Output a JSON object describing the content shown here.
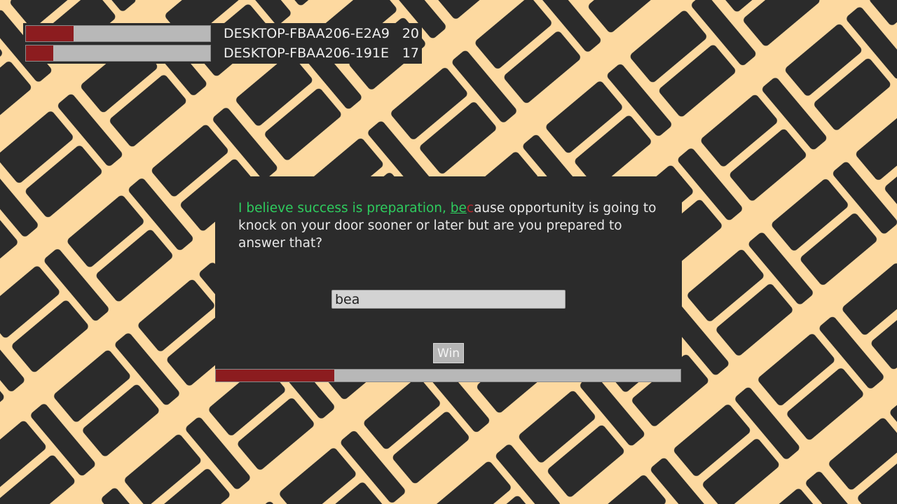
{
  "colors": {
    "background": "#fdd9a0",
    "pattern": "#2b2b2b",
    "panel": "#2b2b2b",
    "progress_fill": "#8c1c1f",
    "progress_track": "#b8b8b8",
    "typed_text": "#2ecc5e",
    "error_text": "#b3262c",
    "remaining_text": "#e8e8e8"
  },
  "leaderboard": {
    "players": [
      {
        "name": "DESKTOP-FBAA206-E2A9",
        "score": "20",
        "progress": 0.26
      },
      {
        "name": "DESKTOP-FBAA206-191E",
        "score": "17",
        "progress": 0.15
      }
    ]
  },
  "quote": {
    "typed": "I believe success is preparation, ",
    "current_correct": "be",
    "error_char": "c",
    "remaining": "ause opportunity is going to knock on your door sooner or later but are you prepared to answer that?"
  },
  "input": {
    "value": "bea"
  },
  "win_button": {
    "label": "Win"
  },
  "progress": {
    "value": 0.255
  }
}
